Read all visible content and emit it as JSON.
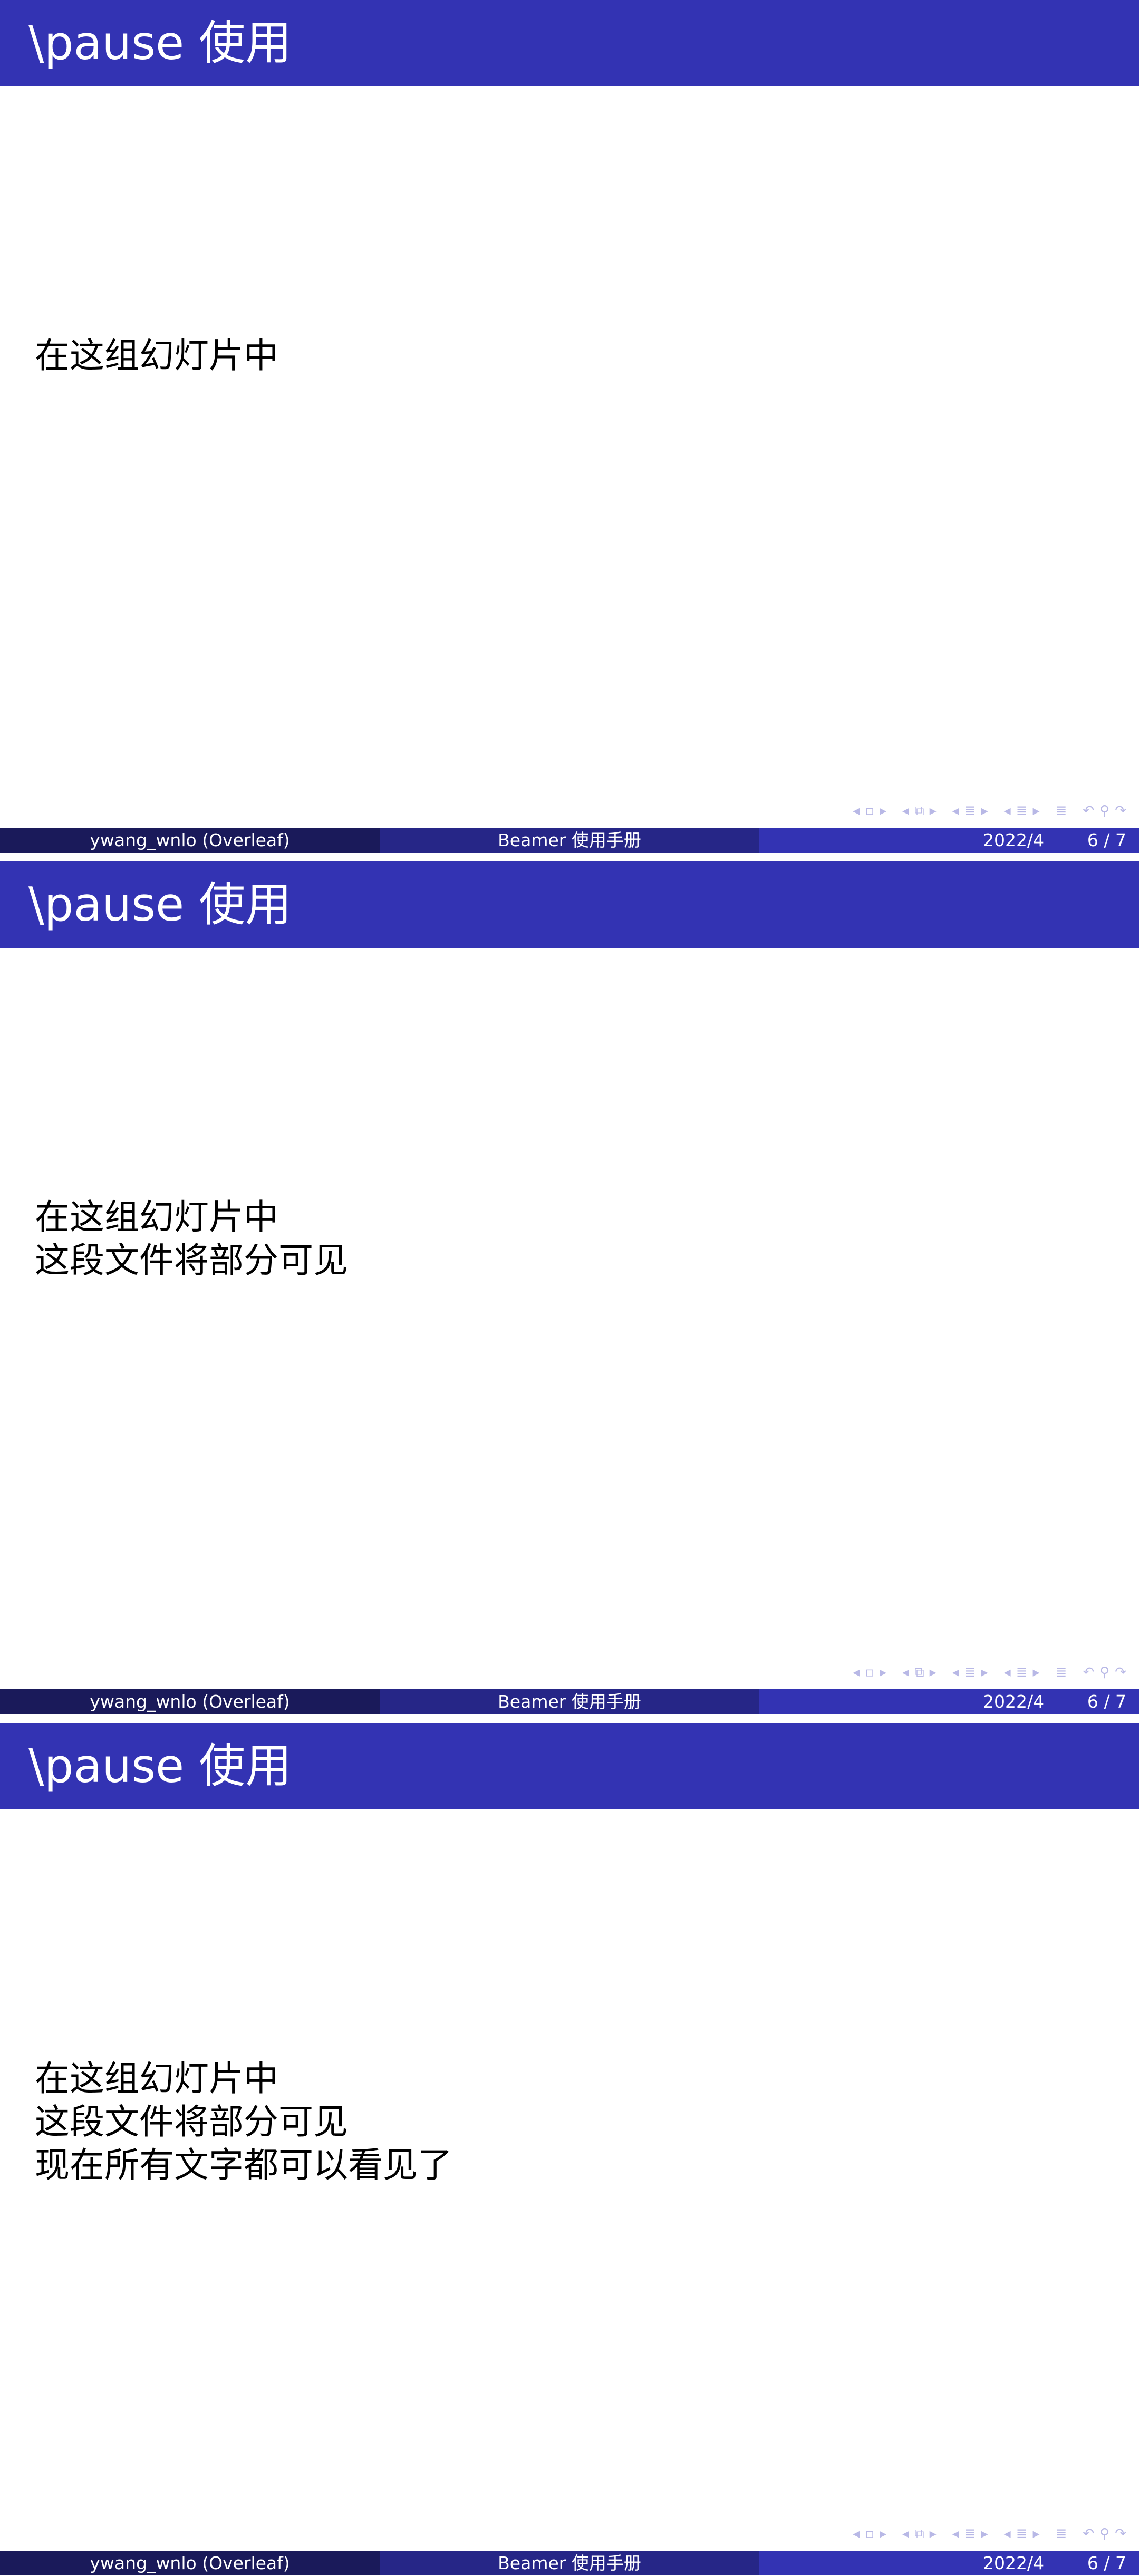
{
  "slides": [
    {
      "title": "\\pause 使用",
      "lines": [
        "在这组幻灯片中"
      ],
      "footer": {
        "author": "ywang_wnlo  (Overleaf)",
        "title": "Beamer 使用手册",
        "date": "2022/4",
        "page": "6 / 7"
      }
    },
    {
      "title": "\\pause 使用",
      "lines": [
        "在这组幻灯片中",
        "这段文件将部分可见"
      ],
      "footer": {
        "author": "ywang_wnlo  (Overleaf)",
        "title": "Beamer 使用手册",
        "date": "2022/4",
        "page": "6 / 7"
      }
    },
    {
      "title": "\\pause 使用",
      "lines": [
        "在这组幻灯片中",
        "这段文件将部分可见",
        "现在所有文字都可以看见了"
      ],
      "footer": {
        "author": "ywang_wnlo  (Overleaf)",
        "title": "Beamer 使用手册",
        "date": "2022/4",
        "page": "6 / 7"
      }
    }
  ],
  "navigation_icons": [
    "nav-prev-frame-icon",
    "nav-frame-icon",
    "nav-next-frame-icon",
    "nav-prev-subsection-icon",
    "nav-subsection-icon",
    "nav-next-subsection-icon",
    "nav-prev-section-icon",
    "nav-section-icon",
    "nav-next-section-icon",
    "nav-prev-part-icon",
    "nav-part-icon",
    "nav-next-part-icon",
    "nav-document-icon",
    "nav-back-icon",
    "nav-search-icon",
    "nav-forward-icon"
  ],
  "colors": {
    "title_bar": "#3333b3",
    "footer_author": "#1a1a5a",
    "footer_title": "#262687",
    "footer_right": "#3333b3",
    "nav_icons": "#b8b8e6"
  }
}
